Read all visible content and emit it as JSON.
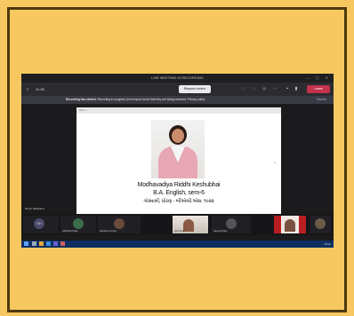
{
  "window": {
    "title": "LIVE MEETING IS RECORDING",
    "controls": "— ▢ ✕"
  },
  "toolbar": {
    "people_label": "≡",
    "timer": "41:56",
    "request_control": "Request control",
    "leave_label": "Leave"
  },
  "recording_banner": {
    "title": "Recording has started.",
    "message": "Recording in progress; let everyone know that they are being recorded. Privacy policy",
    "dismiss": "Dismiss"
  },
  "presentation": {
    "slide_header": "Slide 1",
    "caption_line1": "Modhavadiya Riddhi Keshubhai",
    "caption_line2": "B.A. English, sem-6",
    "caption_line3": "ગોસ્વામી, ધોરણ - બીએ/વી.એસ. ૧૯૨૨",
    "next_arrow": "›"
  },
  "participants_label": "Dhruv Makwana",
  "tiles": [
    {
      "initials": "SH",
      "name": ""
    },
    {
      "initials": "",
      "name": "Abhishek Patel"
    },
    {
      "initials": "",
      "name": "Raushan Kumar"
    },
    {
      "initials": "",
      "name": "Ajit Nayak"
    },
    {
      "initials": "",
      "name": "Aayush Patel"
    },
    {
      "initials": "",
      "name": ""
    }
  ],
  "taskbar": {
    "time": "18:02"
  },
  "colors": {
    "background": "#f7c862",
    "frame_border": "#4d3a10",
    "leave_button": "#c4314b",
    "taskbar": "#0f2f63"
  }
}
